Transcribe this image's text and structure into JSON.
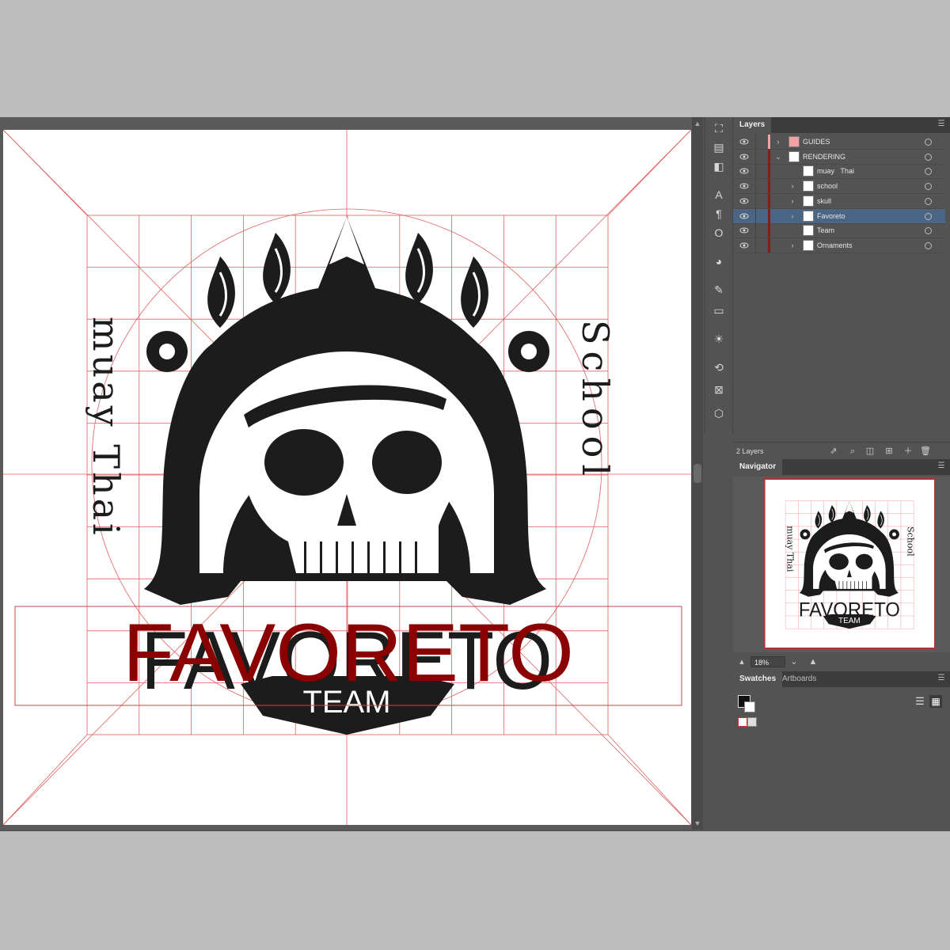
{
  "layers_panel": {
    "tab_label": "Layers",
    "menu_icon": "hamburger-icon",
    "layers": [
      {
        "name": "GUIDES",
        "level": 0,
        "expandable": true,
        "expanded": false,
        "color": "#f4a0a0",
        "selected": false,
        "visible": true
      },
      {
        "name": "RENDERING",
        "level": 0,
        "expandable": true,
        "expanded": true,
        "color": "#8b1a1a",
        "selected": false,
        "visible": true
      },
      {
        "name": "muay   Thai",
        "level": 1,
        "expandable": false,
        "expanded": false,
        "color": "#8b1a1a",
        "selected": false,
        "visible": true
      },
      {
        "name": "school",
        "level": 1,
        "expandable": true,
        "expanded": false,
        "color": "#8b1a1a",
        "selected": false,
        "visible": true
      },
      {
        "name": "skull",
        "level": 1,
        "expandable": true,
        "expanded": false,
        "color": "#8b1a1a",
        "selected": false,
        "visible": true
      },
      {
        "name": "Favoreto",
        "level": 1,
        "expandable": true,
        "expanded": false,
        "color": "#8b1a1a",
        "selected": true,
        "visible": true
      },
      {
        "name": "Team",
        "level": 1,
        "expandable": false,
        "expanded": false,
        "color": "#8b1a1a",
        "selected": false,
        "visible": true
      },
      {
        "name": "Ornaments",
        "level": 1,
        "expandable": true,
        "expanded": false,
        "color": "#8b1a1a",
        "selected": false,
        "visible": true
      }
    ],
    "footer_count": "2 Layers"
  },
  "navigator_panel": {
    "tab_label": "Navigator",
    "zoom": "18%",
    "menu_icon": "hamburger-icon"
  },
  "swatches_panel": {
    "tab_swatches": "Swatches",
    "tab_artboards": "Artboards",
    "menu_icon": "hamburger-icon"
  },
  "artwork": {
    "left_text": "muay Thai",
    "right_text": "School",
    "title": "FAVORETO",
    "subtitle": "TEAM",
    "title_color": "#8b0000",
    "ink_color": "#1c1c1c",
    "guide_color": "#e06060"
  },
  "tools": [
    "artboard-tool-icon",
    "align-icon",
    "pathfinder-icon",
    "character-icon",
    "paragraph-icon",
    "glyphs-icon",
    "color-icon",
    "brush-icon",
    "gradient-icon",
    "appearance-icon",
    "transform-icon",
    "image-trace-icon",
    "3d-icon"
  ]
}
